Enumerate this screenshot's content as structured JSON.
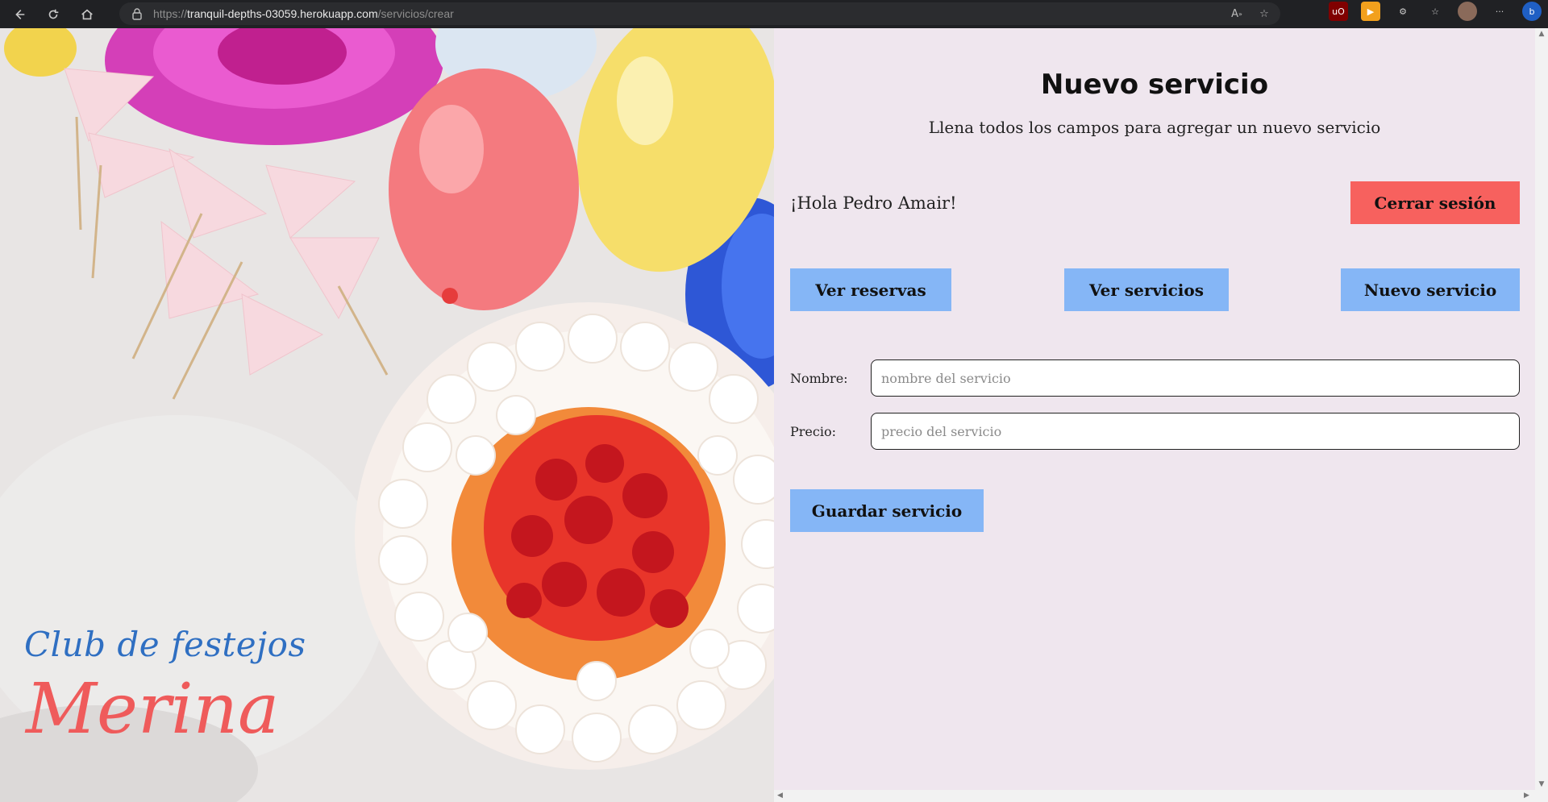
{
  "browser": {
    "url_scheme": "https://",
    "url_host": "tranquil-depths-03059.herokuapp.com",
    "url_path": "/servicios/crear",
    "nav_icons": [
      "back-icon",
      "reload-icon",
      "home-icon"
    ],
    "toolbar_icons": [
      "read-aloud-icon",
      "add-favorite-icon",
      "ublock-extension-icon",
      "play-extension-icon",
      "extensions-icon",
      "favorites-icon",
      "profile-avatar",
      "more-icon",
      "bing-icon"
    ]
  },
  "hero": {
    "brand_line1": "Club de festejos",
    "brand_line2": "Merina",
    "brand_color_line1": "#2f6fc2",
    "brand_color_line2": "#ef5b5b"
  },
  "page": {
    "title": "Nuevo servicio",
    "subtitle": "Llena todos los campos para agregar un nuevo servicio",
    "greeting": "¡Hola Pedro Amair!",
    "logout_label": "Cerrar sesión",
    "nav": {
      "reservas": "Ver reservas",
      "servicios": "Ver servicios",
      "nuevo": "Nuevo servicio"
    },
    "form": {
      "nombre_label": "Nombre:",
      "nombre_placeholder": "nombre del servicio",
      "precio_label": "Precio:",
      "precio_placeholder": "precio del servicio",
      "save_label": "Guardar servicio"
    }
  },
  "colors": {
    "background": "#efe6ee",
    "button_blue": "#85b6f6",
    "button_red": "#f7615e"
  }
}
